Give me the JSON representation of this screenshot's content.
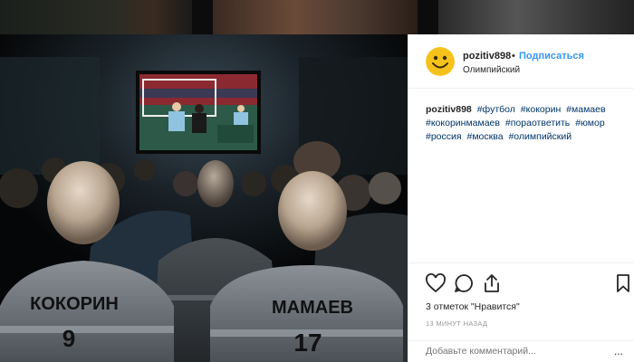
{
  "post": {
    "username": "pozitiv898",
    "separator": "•",
    "follow_label": "Подписаться",
    "location": "Олимпийский",
    "caption_user": "pozitiv898",
    "hashtags": [
      "#футбол",
      "#кокорин",
      "#мамаев",
      "#кокоринмамаев",
      "#пораответить",
      "#юмор",
      "#россия",
      "#москва",
      "#олимпийский"
    ],
    "likes_text": "3 отметок \"Нравится\"",
    "time_text": "13 МИНУТ НАЗАД",
    "comment_placeholder": "Добавьте комментарий...",
    "more_label": "..."
  },
  "photo": {
    "shirt_left_name": "КОКОРИН",
    "shirt_left_number": "9",
    "shirt_right_name": "МАМАЕВ",
    "shirt_right_number": "17"
  },
  "colors": {
    "link_blue": "#3897f0",
    "hashtag_blue": "#003569",
    "text": "#262626",
    "muted": "#999999"
  },
  "icons": {
    "like": "heart-icon",
    "comment": "comment-icon",
    "share": "share-icon",
    "save": "bookmark-icon",
    "avatar": "smiley-avatar"
  }
}
